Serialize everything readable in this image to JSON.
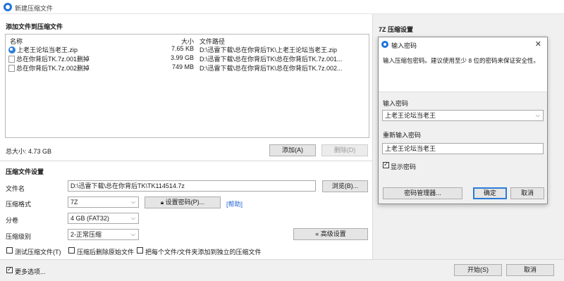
{
  "window": {
    "title": "新建压缩文件"
  },
  "add_section": {
    "heading": "添加文件到压缩文件"
  },
  "file_list": {
    "headers": {
      "name": "名称",
      "size": "大小",
      "path": "文件路径"
    },
    "rows": [
      {
        "name": "上老王论坛当老王.zip",
        "size": "7.65 KB",
        "path": "D:\\迅雷下载\\总在你背后TK\\上老王论坛当老王.zip",
        "icon": "zip-file-icon"
      },
      {
        "name": "总在你背后TK.7z.001删掉",
        "size": "3.99 GB",
        "path": "D:\\迅雷下载\\总在你背后TK\\总在你背后TK.7z.001...",
        "icon": "file-icon"
      },
      {
        "name": "总在你背后TK.7z.002删掉",
        "size": "749 MB",
        "path": "D:\\迅雷下载\\总在你背后TK\\总在你背后TK.7z.002...",
        "icon": "file-icon"
      }
    ]
  },
  "total_size": "总大小: 4.73 GB",
  "buttons": {
    "add": "添加(A)",
    "delete": "删除(D)",
    "browse": "浏览(B)...",
    "set_password": "设置密码(P)...",
    "help": "[帮助]",
    "advanced": "« 高级设置",
    "start": "开始(S)",
    "cancel": "取消"
  },
  "settings": {
    "heading": "压缩文件设置",
    "filename_label": "文件名",
    "filename_value": "D:\\迅雷下载\\总在你背后TK\\TK114514.7z",
    "format_label": "压缩格式",
    "format_value": "7Z",
    "split_label": "分卷",
    "split_value": "4 GB (FAT32)",
    "level_label": "压缩级别",
    "level_value": "2-正常压缩",
    "test_archive": "测试压缩文件(T)",
    "delete_after": "压缩后删除原始文件",
    "each_separate": "把每个文件/文件夹添加到独立的压缩文件"
  },
  "more_options": "更多选项...",
  "right_panel": {
    "heading": "7Z 压缩设置"
  },
  "password_dialog": {
    "title": "输入密码",
    "hint": "输入压缩包密码。建议使用至少 8 位的密码来保证安全性。",
    "enter_label": "输入密码",
    "enter_value": "上老王论坛当老王",
    "reenter_label": "重新输入密码",
    "reenter_value": "上老王论坛当老王",
    "show_password": "显示密码",
    "password_manager": "密码管理器...",
    "ok": "确定",
    "cancel": "取消",
    "close": "✕"
  }
}
